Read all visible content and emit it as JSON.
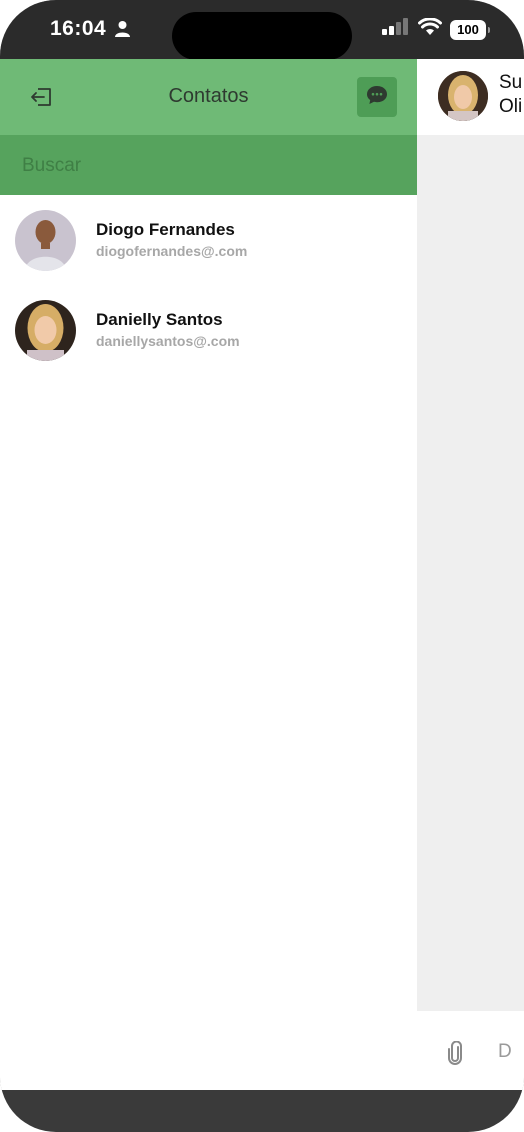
{
  "status": {
    "time": "16:04",
    "battery": "100"
  },
  "contacts_panel": {
    "title": "Contatos",
    "search_placeholder": "Buscar",
    "contacts": [
      {
        "name": "Diogo Fernandes",
        "email": "diogofernandes@.com"
      },
      {
        "name": "Danielly Santos",
        "email": "daniellysantos@.com"
      }
    ]
  },
  "chat": {
    "contact_name": "Su\nOli",
    "input_hint": "D"
  },
  "colors": {
    "header_green": "#6fba76",
    "search_green": "#56a35d",
    "button_green": "#4e9d56"
  },
  "icons": [
    "person-icon",
    "signal-icon",
    "wifi-icon",
    "back-arrow-icon",
    "chat-bubble-icon",
    "paperclip-icon"
  ]
}
